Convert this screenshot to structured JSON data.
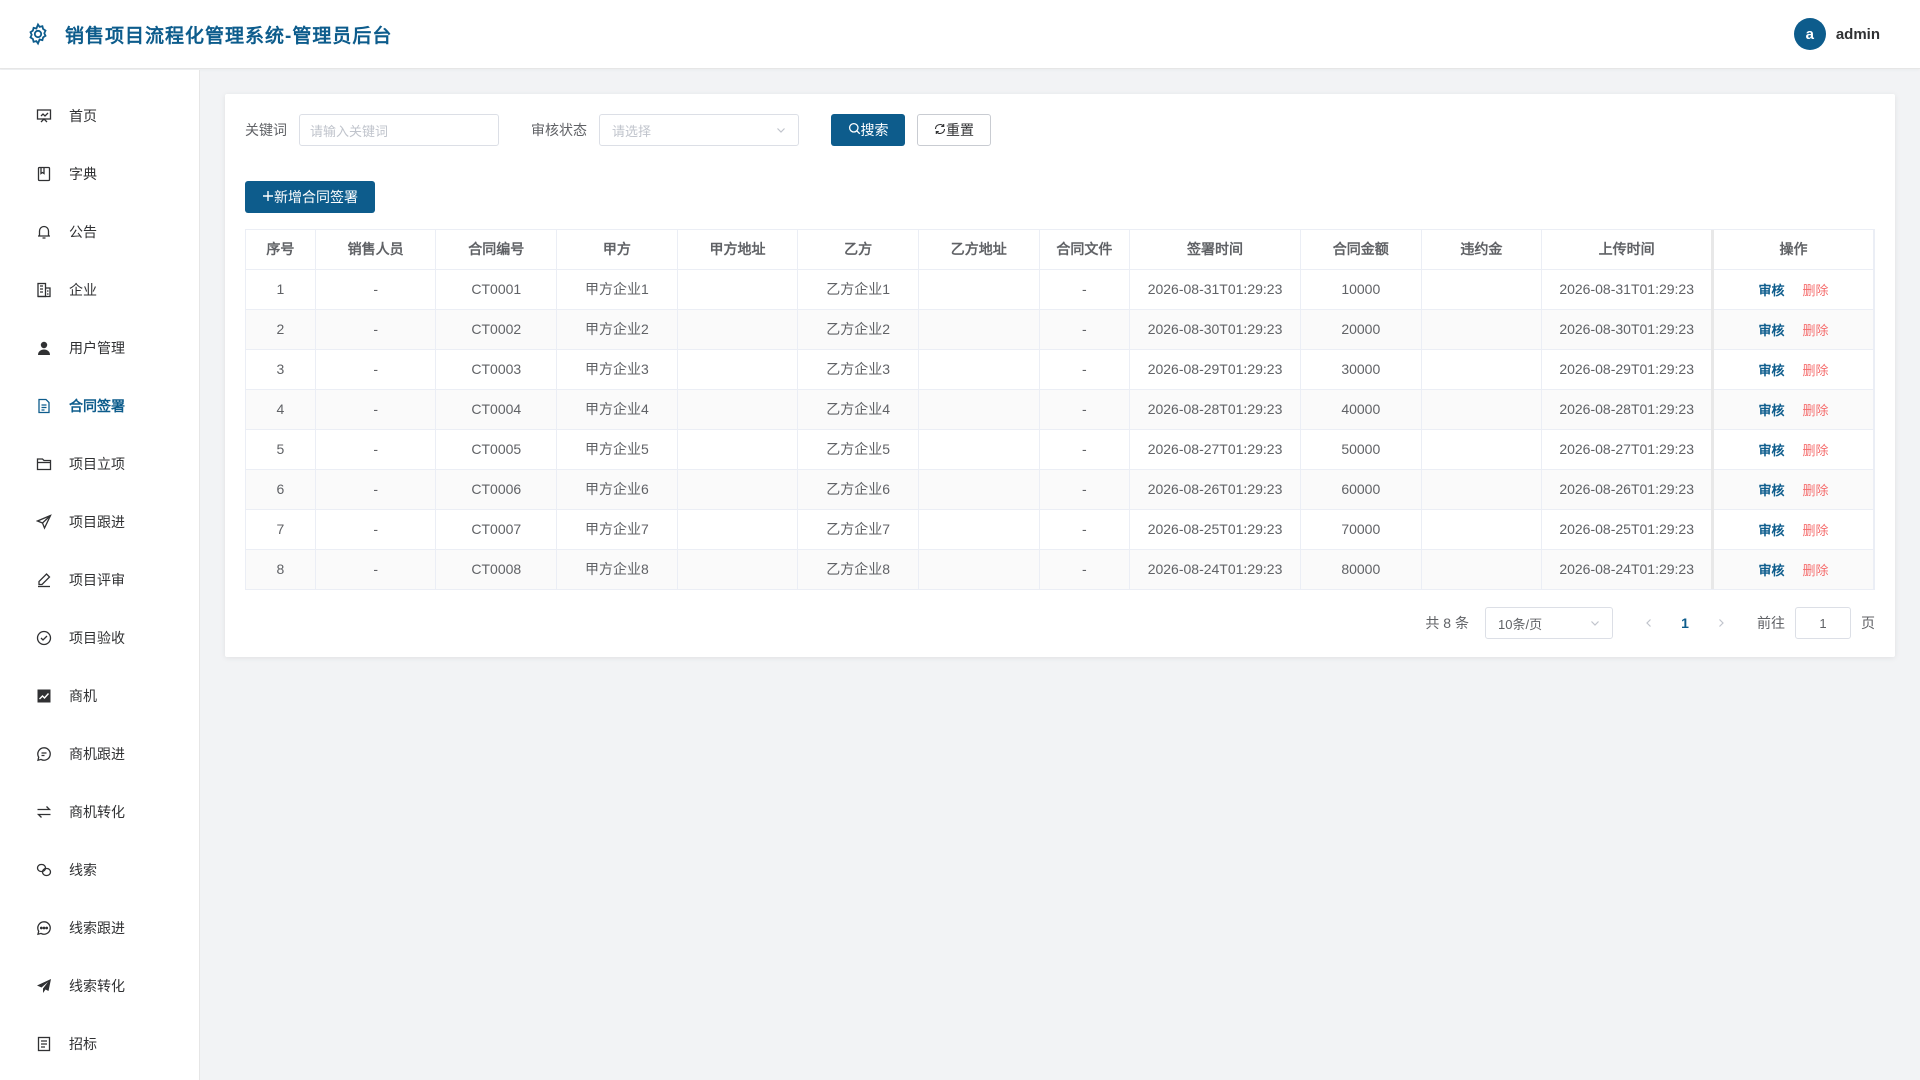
{
  "header": {
    "title": "销售项目流程化管理系统-管理员后台",
    "avatar_letter": "a",
    "username": "admin"
  },
  "sidebar": {
    "items": [
      {
        "label": "首页",
        "icon": "presentation-icon"
      },
      {
        "label": "字典",
        "icon": "book-icon"
      },
      {
        "label": "公告",
        "icon": "bell-icon"
      },
      {
        "label": "企业",
        "icon": "office-building-icon"
      },
      {
        "label": "用户管理",
        "icon": "user-icon"
      },
      {
        "label": "合同签署",
        "icon": "document-icon",
        "active": true
      },
      {
        "label": "项目立项",
        "icon": "folder-icon"
      },
      {
        "label": "项目跟进",
        "icon": "send-icon"
      },
      {
        "label": "项目评审",
        "icon": "edit-pen-icon"
      },
      {
        "label": "项目验收",
        "icon": "check-circle-icon"
      },
      {
        "label": "商机",
        "icon": "chart-icon"
      },
      {
        "label": "商机跟进",
        "icon": "chat-icon"
      },
      {
        "label": "商机转化",
        "icon": "switch-icon"
      },
      {
        "label": "线索",
        "icon": "link-icon"
      },
      {
        "label": "线索跟进",
        "icon": "chat-dots-icon"
      },
      {
        "label": "线索转化",
        "icon": "paper-plane-icon"
      },
      {
        "label": "招标",
        "icon": "tickets-icon"
      }
    ]
  },
  "filters": {
    "keyword_label": "关键词",
    "keyword_placeholder": "请输入关键词",
    "status_label": "审核状态",
    "status_placeholder": "请选择",
    "search_label": "搜索",
    "reset_label": "重置"
  },
  "add_button_label": "新增合同签署",
  "table": {
    "columns": [
      "序号",
      "销售人员",
      "合同编号",
      "甲方",
      "甲方地址",
      "乙方",
      "乙方地址",
      "合同文件",
      "签署时间",
      "合同金额",
      "违约金",
      "上传时间",
      "操作"
    ],
    "rows": [
      {
        "no": "1",
        "sales": "-",
        "code": "CT0001",
        "party_a": "甲方企业1",
        "party_a_addr": "",
        "party_b": "乙方企业1",
        "party_b_addr": "",
        "file": "-",
        "sign_time": "2026-08-31T01:29:23",
        "amount": "10000",
        "penalty": "",
        "upload_time": "2026-08-31T01:29:23"
      },
      {
        "no": "2",
        "sales": "-",
        "code": "CT0002",
        "party_a": "甲方企业2",
        "party_a_addr": "",
        "party_b": "乙方企业2",
        "party_b_addr": "",
        "file": "-",
        "sign_time": "2026-08-30T01:29:23",
        "amount": "20000",
        "penalty": "",
        "upload_time": "2026-08-30T01:29:23"
      },
      {
        "no": "3",
        "sales": "-",
        "code": "CT0003",
        "party_a": "甲方企业3",
        "party_a_addr": "",
        "party_b": "乙方企业3",
        "party_b_addr": "",
        "file": "-",
        "sign_time": "2026-08-29T01:29:23",
        "amount": "30000",
        "penalty": "",
        "upload_time": "2026-08-29T01:29:23"
      },
      {
        "no": "4",
        "sales": "-",
        "code": "CT0004",
        "party_a": "甲方企业4",
        "party_a_addr": "",
        "party_b": "乙方企业4",
        "party_b_addr": "",
        "file": "-",
        "sign_time": "2026-08-28T01:29:23",
        "amount": "40000",
        "penalty": "",
        "upload_time": "2026-08-28T01:29:23"
      },
      {
        "no": "5",
        "sales": "-",
        "code": "CT0005",
        "party_a": "甲方企业5",
        "party_a_addr": "",
        "party_b": "乙方企业5",
        "party_b_addr": "",
        "file": "-",
        "sign_time": "2026-08-27T01:29:23",
        "amount": "50000",
        "penalty": "",
        "upload_time": "2026-08-27T01:29:23"
      },
      {
        "no": "6",
        "sales": "-",
        "code": "CT0006",
        "party_a": "甲方企业6",
        "party_a_addr": "",
        "party_b": "乙方企业6",
        "party_b_addr": "",
        "file": "-",
        "sign_time": "2026-08-26T01:29:23",
        "amount": "60000",
        "penalty": "",
        "upload_time": "2026-08-26T01:29:23"
      },
      {
        "no": "7",
        "sales": "-",
        "code": "CT0007",
        "party_a": "甲方企业7",
        "party_a_addr": "",
        "party_b": "乙方企业7",
        "party_b_addr": "",
        "file": "-",
        "sign_time": "2026-08-25T01:29:23",
        "amount": "70000",
        "penalty": "",
        "upload_time": "2026-08-25T01:29:23"
      },
      {
        "no": "8",
        "sales": "-",
        "code": "CT0008",
        "party_a": "甲方企业8",
        "party_a_addr": "",
        "party_b": "乙方企业8",
        "party_b_addr": "",
        "file": "-",
        "sign_time": "2026-08-24T01:29:23",
        "amount": "80000",
        "penalty": "",
        "upload_time": "2026-08-24T01:29:23"
      }
    ],
    "action_audit": "审核",
    "action_delete": "删除"
  },
  "pagination": {
    "total_text": "共 8 条",
    "page_size": "10条/页",
    "current_page": "1",
    "goto_label": "前往",
    "goto_value": "1",
    "page_unit": "页"
  },
  "colors": {
    "primary": "#0d5c8c",
    "danger": "#f56c6c"
  }
}
